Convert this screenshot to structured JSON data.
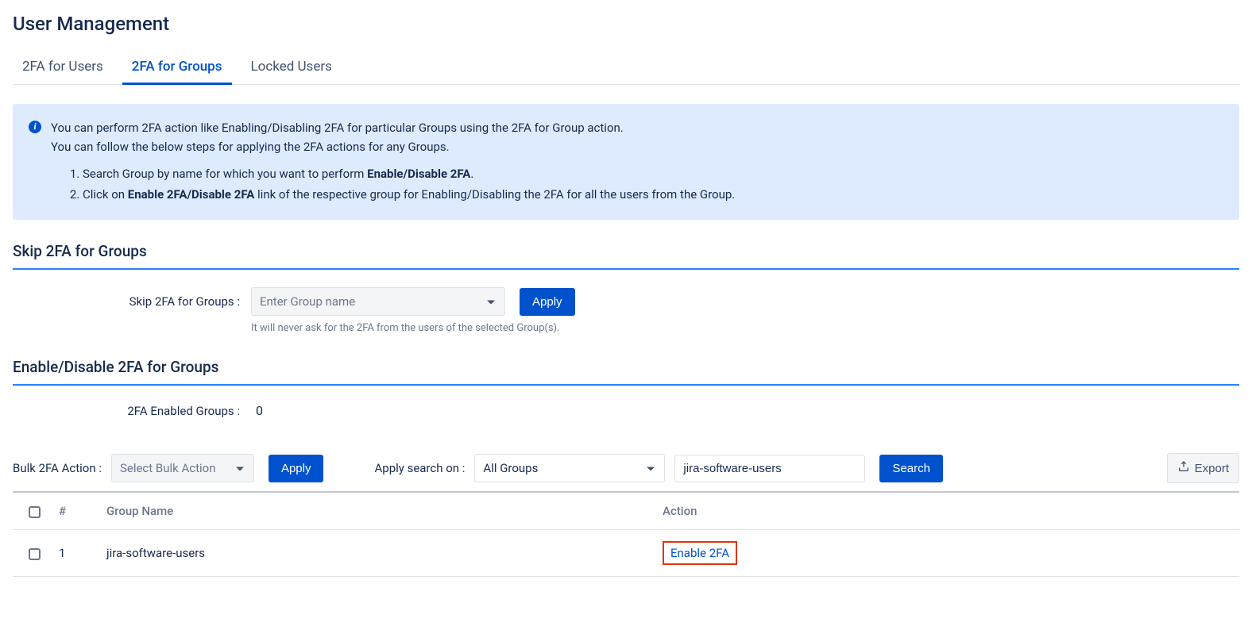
{
  "header": {
    "title": "User Management"
  },
  "tabs": {
    "items": [
      {
        "label": "2FA for Users",
        "active": false
      },
      {
        "label": "2FA for Groups",
        "active": true
      },
      {
        "label": "Locked Users",
        "active": false
      }
    ]
  },
  "infoPanel": {
    "line1": "You can perform 2FA action like Enabling/Disabling 2FA for particular Groups using the 2FA for Group action.",
    "line2": "You can follow the below steps for applying the 2FA actions for any Groups.",
    "step1_prefix": "Search Group by name for which you want to perform ",
    "step1_bold": "Enable/Disable 2FA",
    "step1_suffix": ".",
    "step2_prefix": "Click on ",
    "step2_bold": "Enable 2FA/Disable 2FA",
    "step2_suffix": " link of the respective group for Enabling/Disabling the 2FA for all the users from the Group."
  },
  "skipSection": {
    "heading": "Skip 2FA for Groups",
    "label": "Skip 2FA for Groups :",
    "placeholder": "Enter Group name",
    "applyLabel": "Apply",
    "helper": "It will never ask for the 2FA from the users of the selected Group(s)."
  },
  "enableSection": {
    "heading": "Enable/Disable 2FA for Groups",
    "enabledLabel": "2FA Enabled Groups :",
    "enabledCount": "0"
  },
  "filterBar": {
    "bulkLabel": "Bulk 2FA Action :",
    "bulkSelected": "Select Bulk Action",
    "applyLabel": "Apply",
    "searchOnLabel": "Apply search on :",
    "searchOnSelected": "All Groups",
    "searchValue": "jira-software-users",
    "searchLabel": "Search",
    "exportLabel": "Export"
  },
  "table": {
    "headers": {
      "num": "#",
      "group": "Group Name",
      "action": "Action"
    },
    "rows": [
      {
        "num": "1",
        "group": "jira-software-users",
        "action": "Enable 2FA"
      }
    ]
  }
}
